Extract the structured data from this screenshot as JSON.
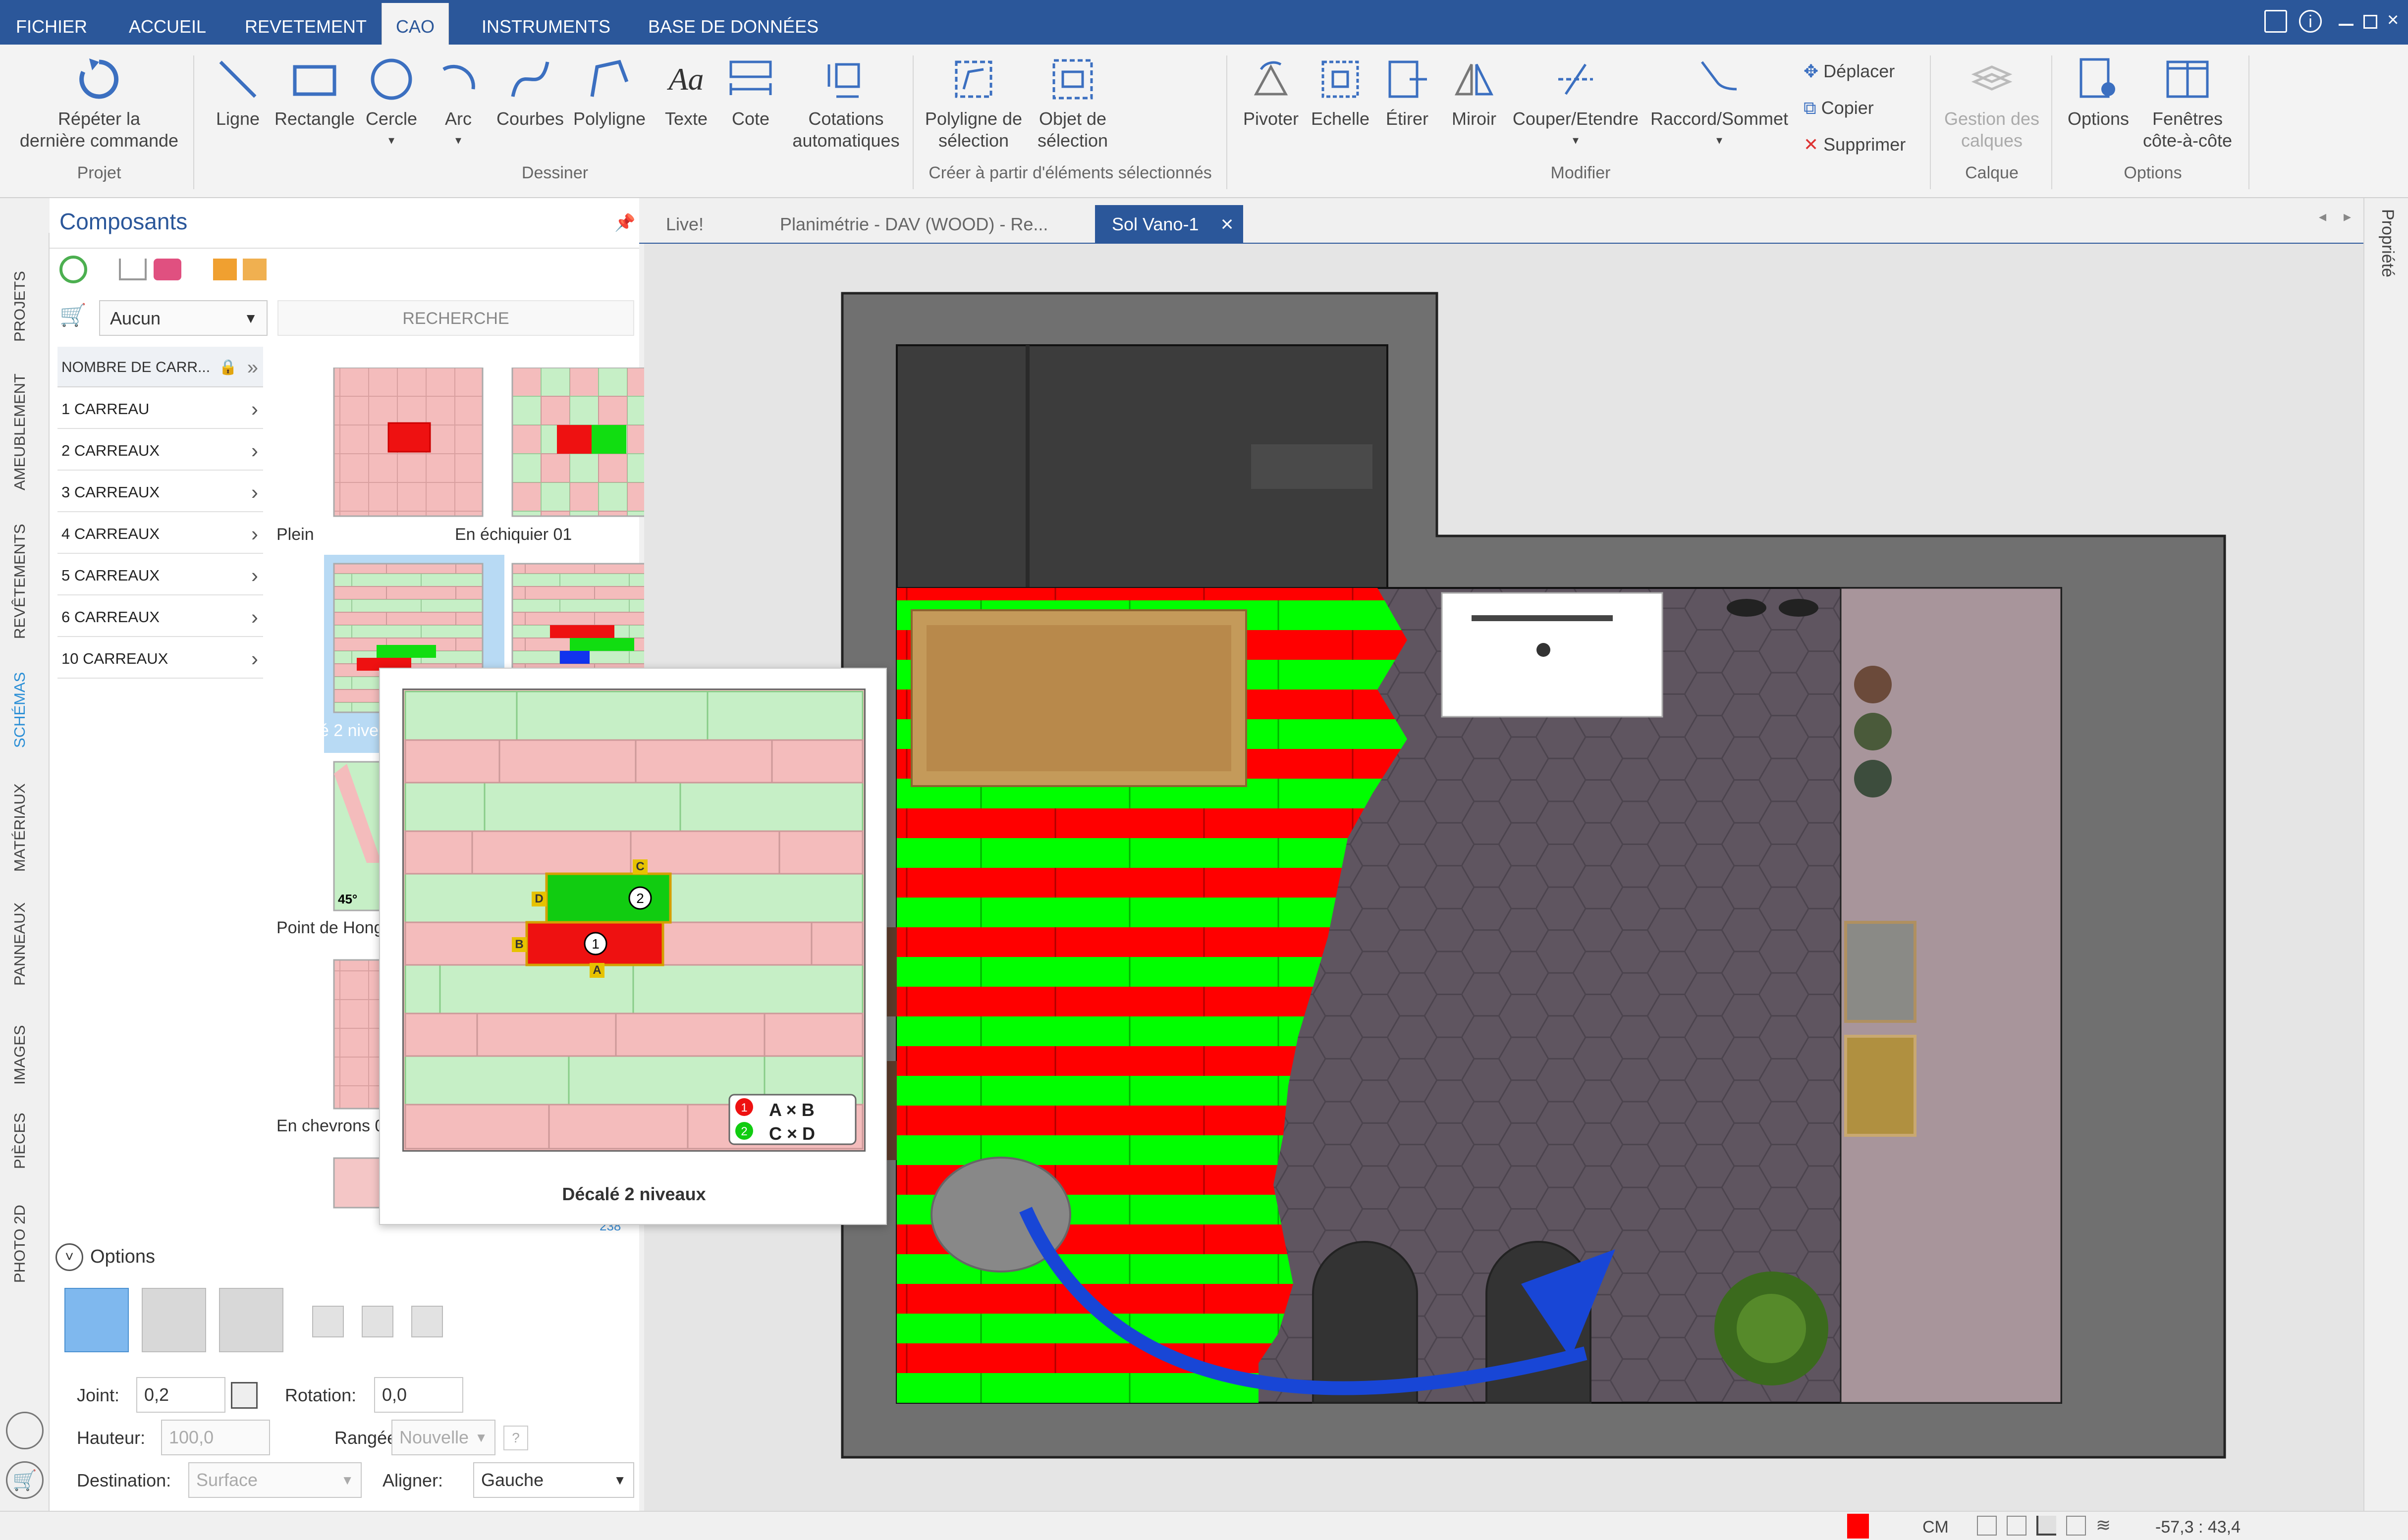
{
  "menu": {
    "tabs": [
      "FICHIER",
      "ACCUEIL",
      "REVETEMENT",
      "CAO",
      "INSTRUMENTS",
      "BASE DE DONNÉES"
    ],
    "active": "CAO"
  },
  "ribbon": {
    "repeat_label_1": "Répéter la",
    "repeat_label_2": "dernière commande",
    "group_projet": "Projet",
    "ligne": "Ligne",
    "rectangle": "Rectangle",
    "cercle": "Cercle",
    "arc": "Arc",
    "courbes": "Courbes",
    "polyligne": "Polyligne",
    "texte": "Texte",
    "cote": "Cote",
    "cotations_1": "Cotations",
    "cotations_2": "automatiques",
    "group_dessiner": "Dessiner",
    "polyligne_sel_1": "Polyligne de",
    "polyligne_sel_2": "sélection",
    "objet_sel_1": "Objet de",
    "objet_sel_2": "sélection",
    "group_creer": "Créer à partir d'éléments sélectionnés",
    "pivoter": "Pivoter",
    "echelle": "Echelle",
    "etirer": "Étirer",
    "miroir": "Miroir",
    "couper": "Couper/Etendre",
    "raccord": "Raccord/Sommet",
    "deplacer": "Déplacer",
    "copier": "Copier",
    "supprimer": "Supprimer",
    "group_modifier": "Modifier",
    "gestion_1": "Gestion des",
    "gestion_2": "calques",
    "group_calque": "Calque",
    "options": "Options",
    "fenetres_1": "Fenêtres",
    "fenetres_2": "côte-à-côte",
    "group_options": "Options"
  },
  "sidetabs": [
    "PROJETS",
    "AMEUBLEMENT",
    "REVÊTEMENTS",
    "SCHÉMAS",
    "MATÉRIAUX",
    "PANNEAUX",
    "IMAGES",
    "PIÈCES",
    "PHOTO 2D"
  ],
  "sidetab_active": "SCHÉMAS",
  "panel": {
    "title": "Composants",
    "dropdown": "Aucun",
    "search": "RECHERCHE",
    "cat_header": "NOMBRE DE CARR...",
    "categories": [
      "1 CARREAU",
      "2 CARREAUX",
      "3 CARREAUX",
      "4 CARREAUX",
      "5 CARREAUX",
      "6 CARREAUX",
      "10 CARREAUX"
    ],
    "thumbs": [
      "Plein",
      "En échiquier 01",
      "Décalé 2 niveaux",
      "Point de Hong",
      "En chevrons 0"
    ],
    "preview_title": "Décalé 2 niveaux",
    "preview_labels": [
      "A",
      "B",
      "C",
      "D"
    ],
    "preview_legend_1": "A × B",
    "preview_legend_2": "C × D",
    "hungarian_label": "45°",
    "scroll_num": "238",
    "options_label": "Options",
    "joint_label": "Joint:",
    "joint_value": "0,2",
    "rotation_label": "Rotation:",
    "rotation_value": "0,0",
    "hauteur_label": "Hauteur:",
    "hauteur_value": "100,0",
    "rangee_label": "Rangée:",
    "rangee_value": "Nouvelle",
    "help": "?",
    "destination_label": "Destination:",
    "destination_value": "Surface",
    "aligner_label": "Aligner:",
    "aligner_value": "Gauche"
  },
  "doc_tabs": [
    "Live!",
    "Planimétrie - DAV (WOOD) - Re...",
    "Sol Vano-1"
  ],
  "doc_tab_active": "Sol Vano-1",
  "right_panel": "Propriété",
  "status": {
    "unit": "CM",
    "coords": "-57,3 : 43,4"
  },
  "colors": {
    "accent": "#2b579a",
    "tile_green": "#00ff00",
    "tile_red": "#ff0000",
    "hex_floor": "#5f5560",
    "arrow": "#1846d6"
  }
}
